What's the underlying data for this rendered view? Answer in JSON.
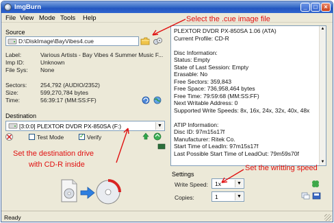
{
  "window": {
    "title": "ImgBurn"
  },
  "menu": [
    "File",
    "View",
    "Mode",
    "Tools",
    "Help"
  ],
  "source": {
    "label": "Source",
    "path": "D:\\DiskImage\\BayVibes4.cue",
    "fields": [
      {
        "name": "Label:",
        "value": "Various Artists - Bay Vibes 4 Summer Music F..."
      },
      {
        "name": "Imp ID:",
        "value": "Unknown"
      },
      {
        "name": "File Sys:",
        "value": "None"
      }
    ],
    "stats": [
      {
        "name": "Sectors:",
        "value": "254,792 (AUDIO/2352)"
      },
      {
        "name": "Size:",
        "value": "599,270,784 bytes"
      },
      {
        "name": "Time:",
        "value": "56:39:17 (MM:SS:FF)"
      }
    ]
  },
  "destination": {
    "label": "Destination",
    "drive": "[3:0:0] PLEXTOR DVDR   PX-850SA (F:)",
    "test_mode_label": "Test Mode",
    "test_mode_checked": false,
    "verify_label": "Verify",
    "verify_checked": true
  },
  "device_info": [
    "PLEXTOR DVDR   PX-850SA 1.06 (ATA)",
    "Current Profile: CD-R",
    "",
    "Disc Information:",
    "Status: Empty",
    "State of Last Session: Empty",
    "Erasable: No",
    "Free Sectors: 359,843",
    "Free Space: 736,958,464 bytes",
    "Free Time: 79:59:68 (MM:SS:FF)",
    "Next Writable Address: 0",
    "Supported Write Speeds: 8x, 16x, 24x, 32x, 40x, 48x",
    "",
    "ATIP Information:",
    "Disc ID: 97m15s17f",
    "Manufacturer: Ritek Co.",
    "Start Time of LeadIn: 97m15s17f",
    "Last Possible Start Time of LeadOut: 79m59s70f"
  ],
  "settings": {
    "label": "Settings",
    "write_speed_label": "Write Speed:",
    "write_speed_value": "1x",
    "copies_label": "Copies:",
    "copies_value": "1"
  },
  "annotations": {
    "select_cue": "Select the .cue image file",
    "set_drive_line1": "Set the destination drive",
    "set_drive_line2": "with CD-R inside",
    "set_speed": "Set the writting speed"
  },
  "status": {
    "text": "Ready"
  },
  "colors": {
    "annotation": "#e01010",
    "titlebar": "#2456c0",
    "window_bg": "#ece9d8"
  }
}
